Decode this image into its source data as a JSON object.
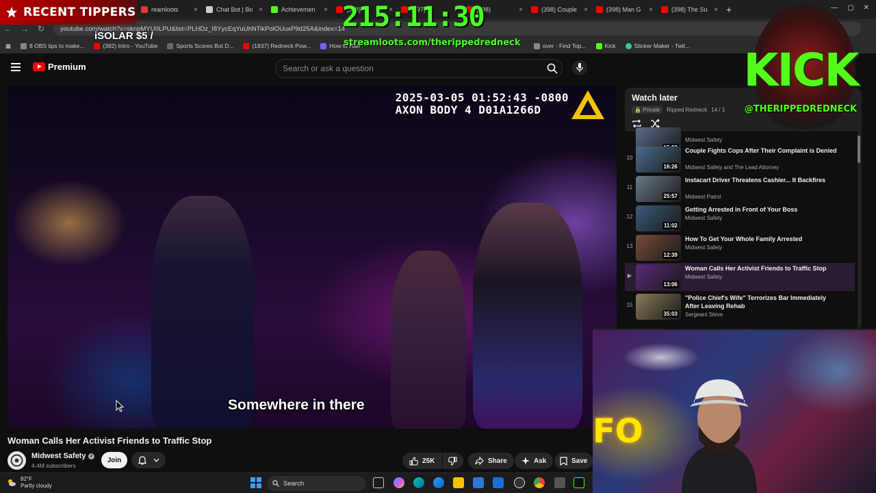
{
  "browser": {
    "tabs": [
      {
        "label": "reamloots",
        "color": "#e33"
      },
      {
        "label": "Chat Bot | Bo",
        "color": "#ccc"
      },
      {
        "label": "Achievemen",
        "color": "#53fc18"
      },
      {
        "label": "(398)",
        "color": "#f00"
      },
      {
        "label": "(397) W",
        "color": "#f00"
      },
      {
        "label": "(398)",
        "color": "#f00"
      },
      {
        "label": "(398) Couple",
        "color": "#f00"
      },
      {
        "label": "(398) Man G",
        "color": "#f00"
      },
      {
        "label": "(398) The Su",
        "color": "#f00"
      }
    ],
    "url": "youtube.com/watch?v=sknpMYU0LPU&list=PLHDz_I8YycEqYuUhNTikPolOUuxP9d25A&index=14",
    "bookmarks": [
      {
        "label": "8 OBS tips to make...",
        "color": "#888"
      },
      {
        "label": "(382) Intro - YouTube",
        "color": "#f00"
      },
      {
        "label": "Sports Scores Bot D...",
        "color": "#666"
      },
      {
        "label": "(1837) Redneck Pow...",
        "color": "#f00"
      },
      {
        "label": "How to Han",
        "color": "#7a5cff"
      },
      {
        "label": "over - Find Top...",
        "color": "#888"
      },
      {
        "label": "Kick",
        "color": "#53fc18"
      },
      {
        "label": "Sticker Maker - Twit...",
        "color": "#3c9"
      }
    ]
  },
  "youtube": {
    "brand": "Premium",
    "search_placeholder": "Search or ask a question",
    "video": {
      "timestamp_line1": "2025-03-05 01:52:43 -0800",
      "timestamp_line2": "AXON BODY 4 D01A1266D",
      "caption": "Somewhere in there",
      "title": "Woman Calls Her Activist Friends to Traffic Stop",
      "channel": "Midwest Safety",
      "subscribers": "4.4M subscribers",
      "join_label": "Join",
      "likes": "25K",
      "share_label": "Share",
      "ask_label": "Ask",
      "save_label": "Save"
    },
    "playlist": {
      "title": "Watch later",
      "privacy": "Private",
      "owner": "Ripped Redneck",
      "position": "14 / 1",
      "items": [
        {
          "index": "",
          "title": "",
          "channel": "Midwest Safety",
          "duration": "15:03",
          "thumb": "#5a6b8a"
        },
        {
          "index": "10",
          "title": "Couple Fights Cops After Their Complaint is Denied",
          "channel": "Midwest Safety and The Lead Attorney",
          "duration": "16:26",
          "thumb": "#4a6d8f"
        },
        {
          "index": "11",
          "title": "Instacart Driver Threatens Cashier... It Backfires",
          "channel": "Midwest Patrol",
          "duration": "25:57",
          "thumb": "#6a7a8a"
        },
        {
          "index": "12",
          "title": "Getting Arrested in Front of Your Boss",
          "channel": "Midwest Safety",
          "duration": "11:02",
          "thumb": "#3a5a7a"
        },
        {
          "index": "13",
          "title": "How To Get Your Whole Family Arrested",
          "channel": "Midwest Safety",
          "duration": "12:39",
          "thumb": "#7a4a3a"
        },
        {
          "index": "▶",
          "title": "Woman Calls Her Activist Friends to Traffic Stop",
          "channel": "Midwest Safety",
          "duration": "13:06",
          "thumb": "#5a2a7a"
        },
        {
          "index": "15",
          "title": "\"Police Chief's Wife\" Terrorizes Bar Immediately After Leaving Rehab",
          "channel": "Sergeant Steve",
          "duration": "35:03",
          "thumb": "#8a7a5a"
        }
      ]
    }
  },
  "overlay": {
    "tippers_title": "RECENT TIPPERS",
    "tip_line": "iSOLAR $5 /",
    "timer": "215:11:30",
    "timer_url": "streamloots.com/therippedredneck",
    "kick_word": "KICK",
    "kick_handle": "@THERIPPEDREDNECK",
    "cam_sign": "FO"
  },
  "taskbar": {
    "temp": "82°F",
    "weather": "Partly cloudy",
    "search_label": "Search"
  },
  "colors": {
    "accent_green": "#53fc18",
    "yt_red": "#ff0000"
  }
}
